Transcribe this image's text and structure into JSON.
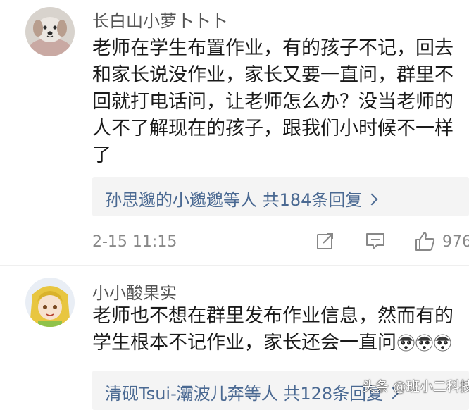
{
  "comments": [
    {
      "username": "长白山小萝卜卜卜",
      "avatar": "dog-avatar",
      "lines": [
        "老师在学生布置作业，有的孩子不记，回去",
        "和家长说没作业，家长又要一直问，群里不",
        "回就打电话问，让老师怎么办？没当老师的",
        "人不了解现在的孩子，跟我们小时候不一样",
        "了"
      ],
      "replies": "孙思邈的小邈邈等人 共184条回复",
      "time": "2-15 11:15",
      "likes": "976",
      "actions": [
        "share-icon",
        "comment-icon",
        "like-icon"
      ]
    },
    {
      "username": "小小酸果实",
      "avatar": "anime-girl-avatar",
      "lines": [
        "老师也不想在群里发布作业信息，然而有的",
        "学生根本不记作业，家长还会一直问"
      ],
      "emoji": [
        "shocked-face-emoji",
        "shocked-face-emoji",
        "shocked-face-emoji"
      ],
      "replies": "清砚Tsui-灞波儿奔等人 共128条回复"
    }
  ],
  "watermark": "头条 @班小二科技",
  "colors": {
    "link": "#4a6992",
    "meta": "#888888",
    "reply_bg": "#f4f4f4",
    "text": "#1a1a1a"
  }
}
